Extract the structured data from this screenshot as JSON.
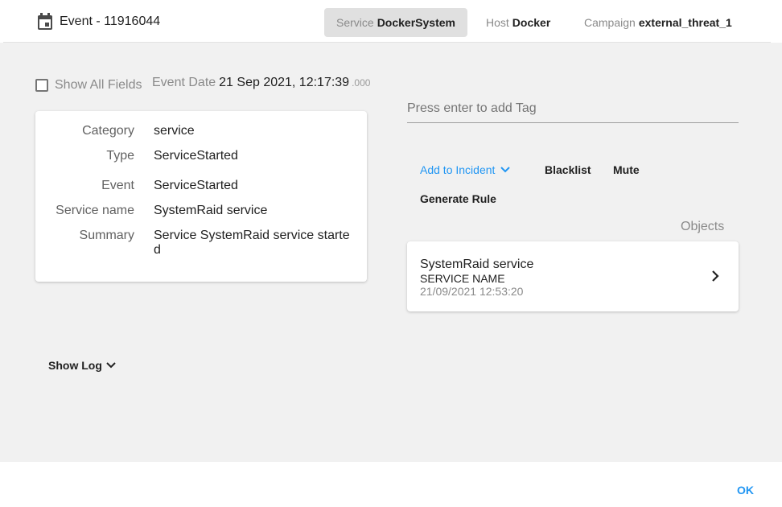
{
  "header": {
    "title": "Event - 11916044",
    "chips": {
      "service": {
        "label": "Service",
        "value": "DockerSystem"
      },
      "host": {
        "label": "Host",
        "value": "Docker"
      },
      "campaign": {
        "label": "Campaign",
        "value": "external_threat_1"
      }
    }
  },
  "filters": {
    "show_all_fields": "Show All Fields",
    "event_date_label": "Event Date",
    "event_date_value": "21 Sep 2021, 12:17:39",
    "event_date_ms": ".000"
  },
  "fields": [
    {
      "key": "Category",
      "value": "service"
    },
    {
      "key": "Type",
      "value": "ServiceStarted"
    },
    {
      "key": "Event",
      "value": "ServiceStarted"
    },
    {
      "key": "Service name",
      "value": "SystemRaid service"
    },
    {
      "key": "Summary",
      "value": "Service SystemRaid service started"
    }
  ],
  "tag_input": {
    "placeholder": "Press enter to add Tag"
  },
  "actions": {
    "add_to_incident": "Add to Incident",
    "blacklist": "Blacklist",
    "mute": "Mute",
    "generate_rule": "Generate Rule"
  },
  "objects": {
    "label": "Objects",
    "items": [
      {
        "name": "SystemRaid service",
        "type": "SERVICE NAME",
        "date": "21/09/2021 12:53:20"
      }
    ]
  },
  "show_log": "Show Log",
  "footer": {
    "ok": "OK"
  },
  "colors": {
    "accent": "#2196f3",
    "background": "#f1f1f1"
  }
}
